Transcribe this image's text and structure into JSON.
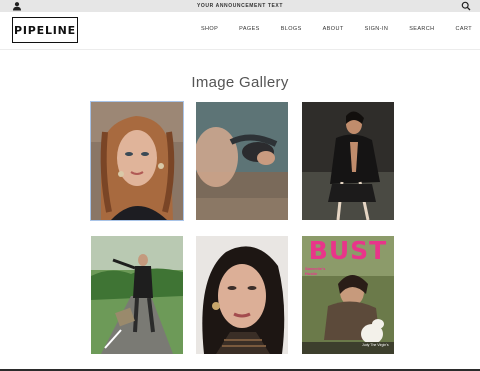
{
  "announcement": {
    "text": "YOUR ANNOUNCEMENT TEXT",
    "left_icon": "user-icon",
    "right_icon": "search-icon"
  },
  "header": {
    "logo": "PIPELINE",
    "nav": [
      "SHOP",
      "PAGES",
      "BLOGS",
      "ABOUT",
      "SIGN-IN",
      "SEARCH",
      "CART"
    ]
  },
  "gallery": {
    "title": "Image Gallery",
    "images": [
      {
        "name": "braided-hair-portrait",
        "selected": true
      },
      {
        "name": "reclining-model-photo",
        "selected": false
      },
      {
        "name": "seated-model-black-outfit",
        "selected": false
      },
      {
        "name": "model-on-road-photo",
        "selected": false
      },
      {
        "name": "dark-hair-closeup-portrait",
        "selected": false
      },
      {
        "name": "bust-magazine-cover",
        "selected": false
      }
    ],
    "magazine_cover": {
      "masthead": "BUST",
      "headline": "Saweetie's Hustle",
      "bottom_text": "Judy The Virgin's"
    }
  },
  "colors": {
    "announcement_bg": "#e6e6e6",
    "selected_outline": "#a9c4e8",
    "magazine_pink": "#e8358a"
  }
}
